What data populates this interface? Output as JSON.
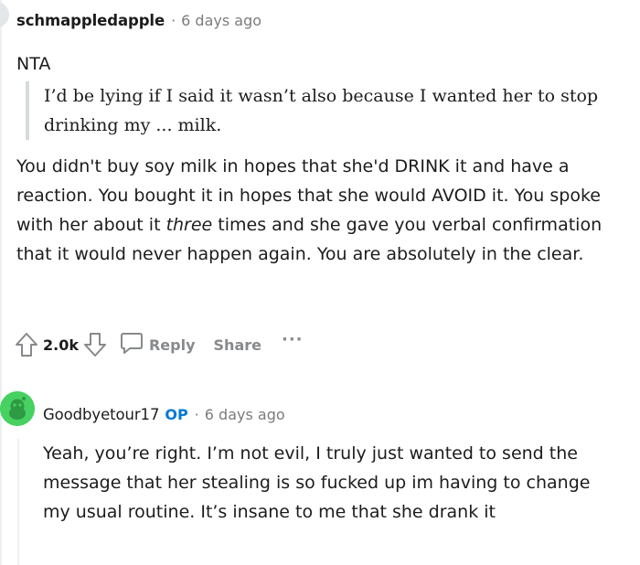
{
  "comment1": {
    "author": "schmappledapple",
    "separator": "·",
    "time": "6 days ago",
    "line1": "NTA",
    "quote": "I’d be lying if I said it wasn’t also because I wanted her to stop drinking my ... milk.",
    "para_a": "You didn't buy soy milk in hopes that she'd DRINK it and have a reaction. You bought it in hopes that she would AVOID it. You spoke with her about it ",
    "para_em": "three",
    "para_b": " times and she gave you verbal confirmation that it would never happen again. You are absolutely in the clear.",
    "actions": {
      "score": "2.0k",
      "reply_label": "Reply",
      "share_label": "Share",
      "more_label": "···"
    }
  },
  "comment2": {
    "author": "Goodbyetour17",
    "op_badge": "OP",
    "separator": "·",
    "time": "6 days ago",
    "body": "Yeah, you’re right. I’m not evil, I truly just wanted to send the message that her stealing is so fucked up im having to change my usual routine. It’s insane to me that she drank it"
  },
  "icons": {
    "upvote": "arrow-up-outline-icon",
    "downvote": "arrow-down-outline-icon",
    "reply": "speech-bubble-icon",
    "avatar": "snoo-avatar-icon"
  },
  "colors": {
    "op": "#0079d3",
    "muted": "#878a8c",
    "avatar_green": "#46d160"
  }
}
